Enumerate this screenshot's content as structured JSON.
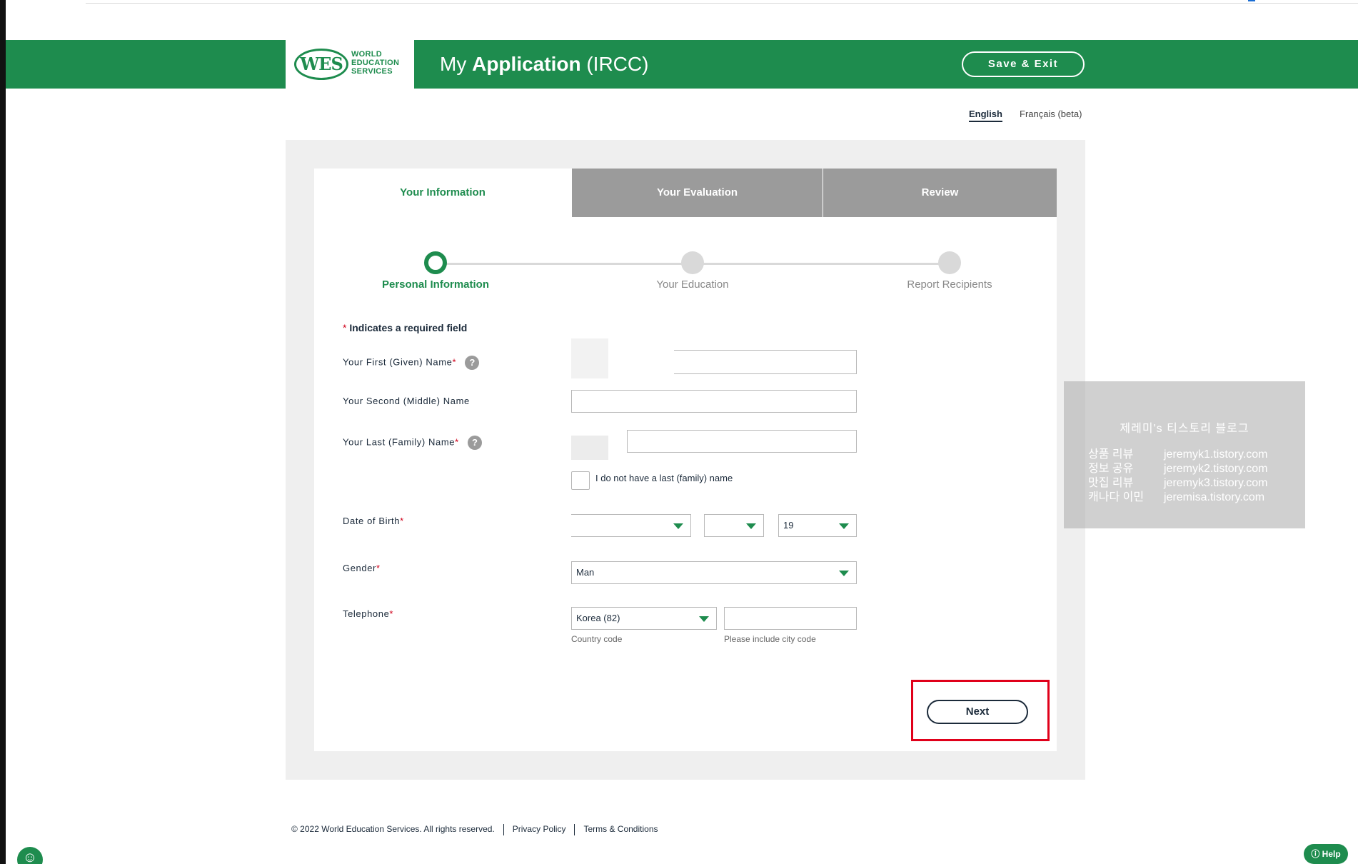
{
  "header": {
    "logo_mark": "WES",
    "logo_lines": [
      "WORLD",
      "EDUCATION",
      "SERVICES"
    ],
    "title_prefix": "My",
    "title_bold": "Application",
    "title_suffix": "(IRCC)",
    "save_exit_label": "Save & Exit"
  },
  "languages": {
    "english": "English",
    "french": "Français (beta)"
  },
  "tabs": [
    {
      "label": "Your Information",
      "active": true
    },
    {
      "label": "Your Evaluation",
      "active": false
    },
    {
      "label": "Review",
      "active": false
    }
  ],
  "steps": [
    {
      "label": "Personal Information",
      "active": true
    },
    {
      "label": "Your Education",
      "active": false
    },
    {
      "label": "Report Recipients",
      "active": false
    }
  ],
  "form": {
    "required_star": "*",
    "required_note": "Indicates a required field",
    "first_name_label": "Your First (Given) Name",
    "middle_name_label": "Your Second (Middle) Name",
    "last_name_label": "Your Last (Family) Name",
    "help_glyph": "?",
    "no_last_name_label": "I do not have a last (family) name",
    "dob_label": "Date of Birth",
    "dob_year_value": "19",
    "gender_label": "Gender",
    "gender_value": "Man",
    "telephone_label": "Telephone",
    "country_code_value": "Korea (82)",
    "country_code_hint": "Country code",
    "phone_hint": "Please include city code",
    "next_label": "Next"
  },
  "watermark": {
    "title": "제레미's 티스토리 블로그",
    "rows": [
      {
        "k": "상품 리뷰",
        "v": "jeremyk1.tistory.com"
      },
      {
        "k": "정보 공유",
        "v": "jeremyk2.tistory.com"
      },
      {
        "k": "맛집 리뷰",
        "v": "jeremyk3.tistory.com"
      },
      {
        "k": "캐나다 이민",
        "v": "jeremisa.tistory.com"
      }
    ]
  },
  "footer": {
    "copyright": "© 2022 World Education Services. All rights reserved.",
    "privacy": "Privacy Policy",
    "terms": "Terms & Conditions"
  },
  "widgets": {
    "help_label": "Help",
    "help_icon": "question-circle-icon",
    "accessibility_icon": "accessibility-person-icon"
  },
  "colors": {
    "brand_green": "#1e8c4e",
    "tab_inactive": "#9b9b9b",
    "required_red": "#d0021b",
    "highlight_red": "#e0001a",
    "text_dark": "#1b2a3a"
  }
}
